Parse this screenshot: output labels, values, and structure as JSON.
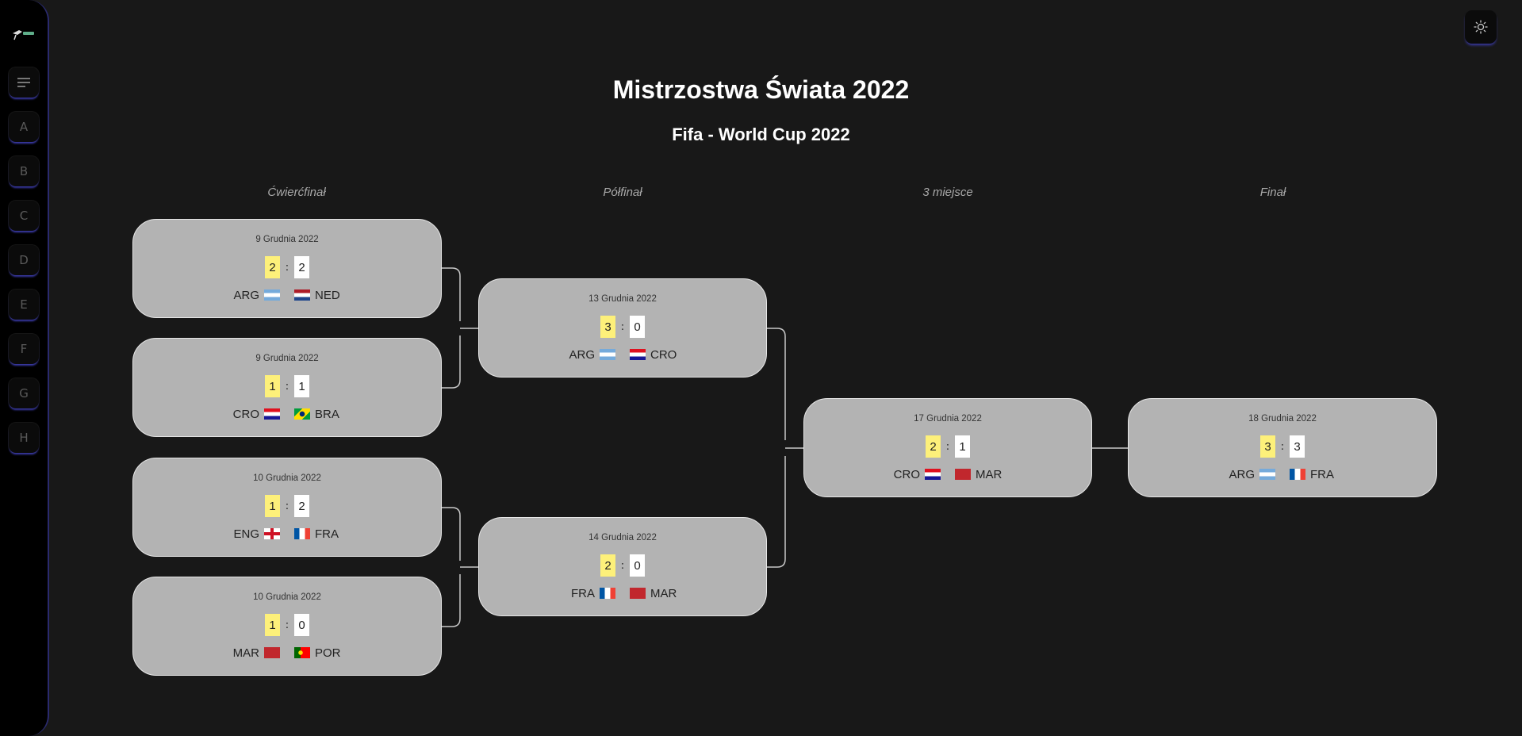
{
  "header": {
    "title": "Mistrzostwa Świata 2022",
    "subtitle": "Fifa - World Cup 2022"
  },
  "sidebar": {
    "logo_icon": "trophy-logo-icon",
    "menu_icon": "menu-icon",
    "groups": [
      "A",
      "B",
      "C",
      "D",
      "E",
      "F",
      "G",
      "H"
    ]
  },
  "theme_toggle_icon": "sun-icon",
  "rounds": {
    "quarterfinal": "Ćwierćfinał",
    "semifinal": "Półfinał",
    "third_place": "3 miejsce",
    "final": "Finał"
  },
  "matches": {
    "qf1": {
      "date": "9 Grudnia 2022",
      "home": "ARG",
      "away": "NED",
      "home_score": "2",
      "away_score": "2"
    },
    "qf2": {
      "date": "9 Grudnia 2022",
      "home": "CRO",
      "away": "BRA",
      "home_score": "1",
      "away_score": "1"
    },
    "qf3": {
      "date": "10 Grudnia 2022",
      "home": "ENG",
      "away": "FRA",
      "home_score": "1",
      "away_score": "2"
    },
    "qf4": {
      "date": "10 Grudnia 2022",
      "home": "MAR",
      "away": "POR",
      "home_score": "1",
      "away_score": "0"
    },
    "sf1": {
      "date": "13 Grudnia 2022",
      "home": "ARG",
      "away": "CRO",
      "home_score": "3",
      "away_score": "0"
    },
    "sf2": {
      "date": "14 Grudnia 2022",
      "home": "FRA",
      "away": "MAR",
      "home_score": "2",
      "away_score": "0"
    },
    "third": {
      "date": "17 Grudnia 2022",
      "home": "CRO",
      "away": "MAR",
      "home_score": "2",
      "away_score": "1"
    },
    "final": {
      "date": "18 Grudnia 2022",
      "home": "ARG",
      "away": "FRA",
      "home_score": "3",
      "away_score": "3"
    }
  },
  "colors": {
    "background": "#181818",
    "card": "#b3b3b3",
    "winner_highlight": "#fdf07a",
    "sidebar_accent": "#3a3aa8"
  }
}
